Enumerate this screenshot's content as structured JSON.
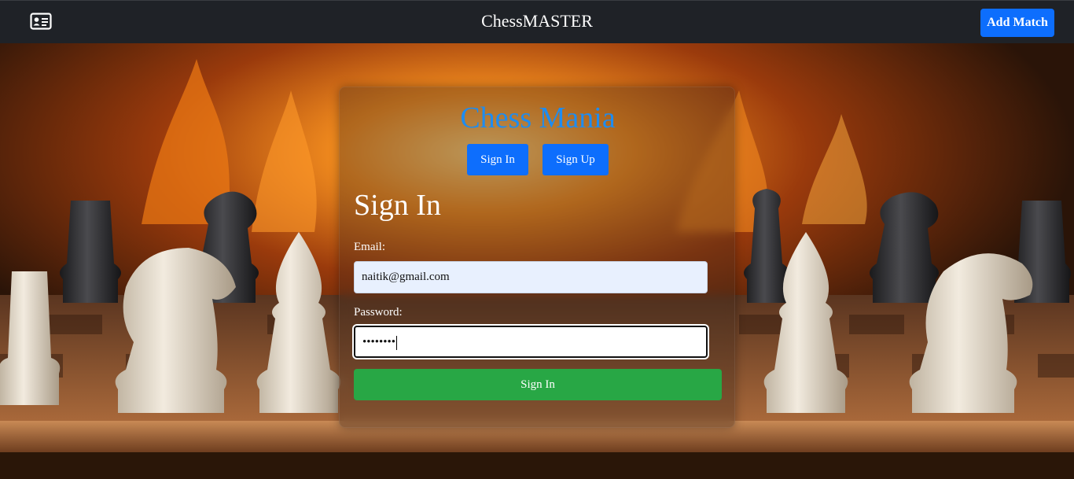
{
  "navbar": {
    "icon": "contact-card-icon",
    "brand": "ChessMASTER",
    "add_match_label": "Add Match"
  },
  "card": {
    "title": "Chess Mania",
    "tabs": [
      {
        "label": "Sign In"
      },
      {
        "label": "Sign Up"
      }
    ],
    "heading": "Sign In",
    "email_label": "Email:",
    "email_value": "naitik@gmail.com",
    "password_label": "Password:",
    "password_value": "••••••••",
    "submit_label": "Sign In"
  },
  "colors": {
    "navbar_bg": "#1f2227",
    "primary": "#0d6efd",
    "title": "#1e8cf0",
    "success": "#28a745"
  }
}
